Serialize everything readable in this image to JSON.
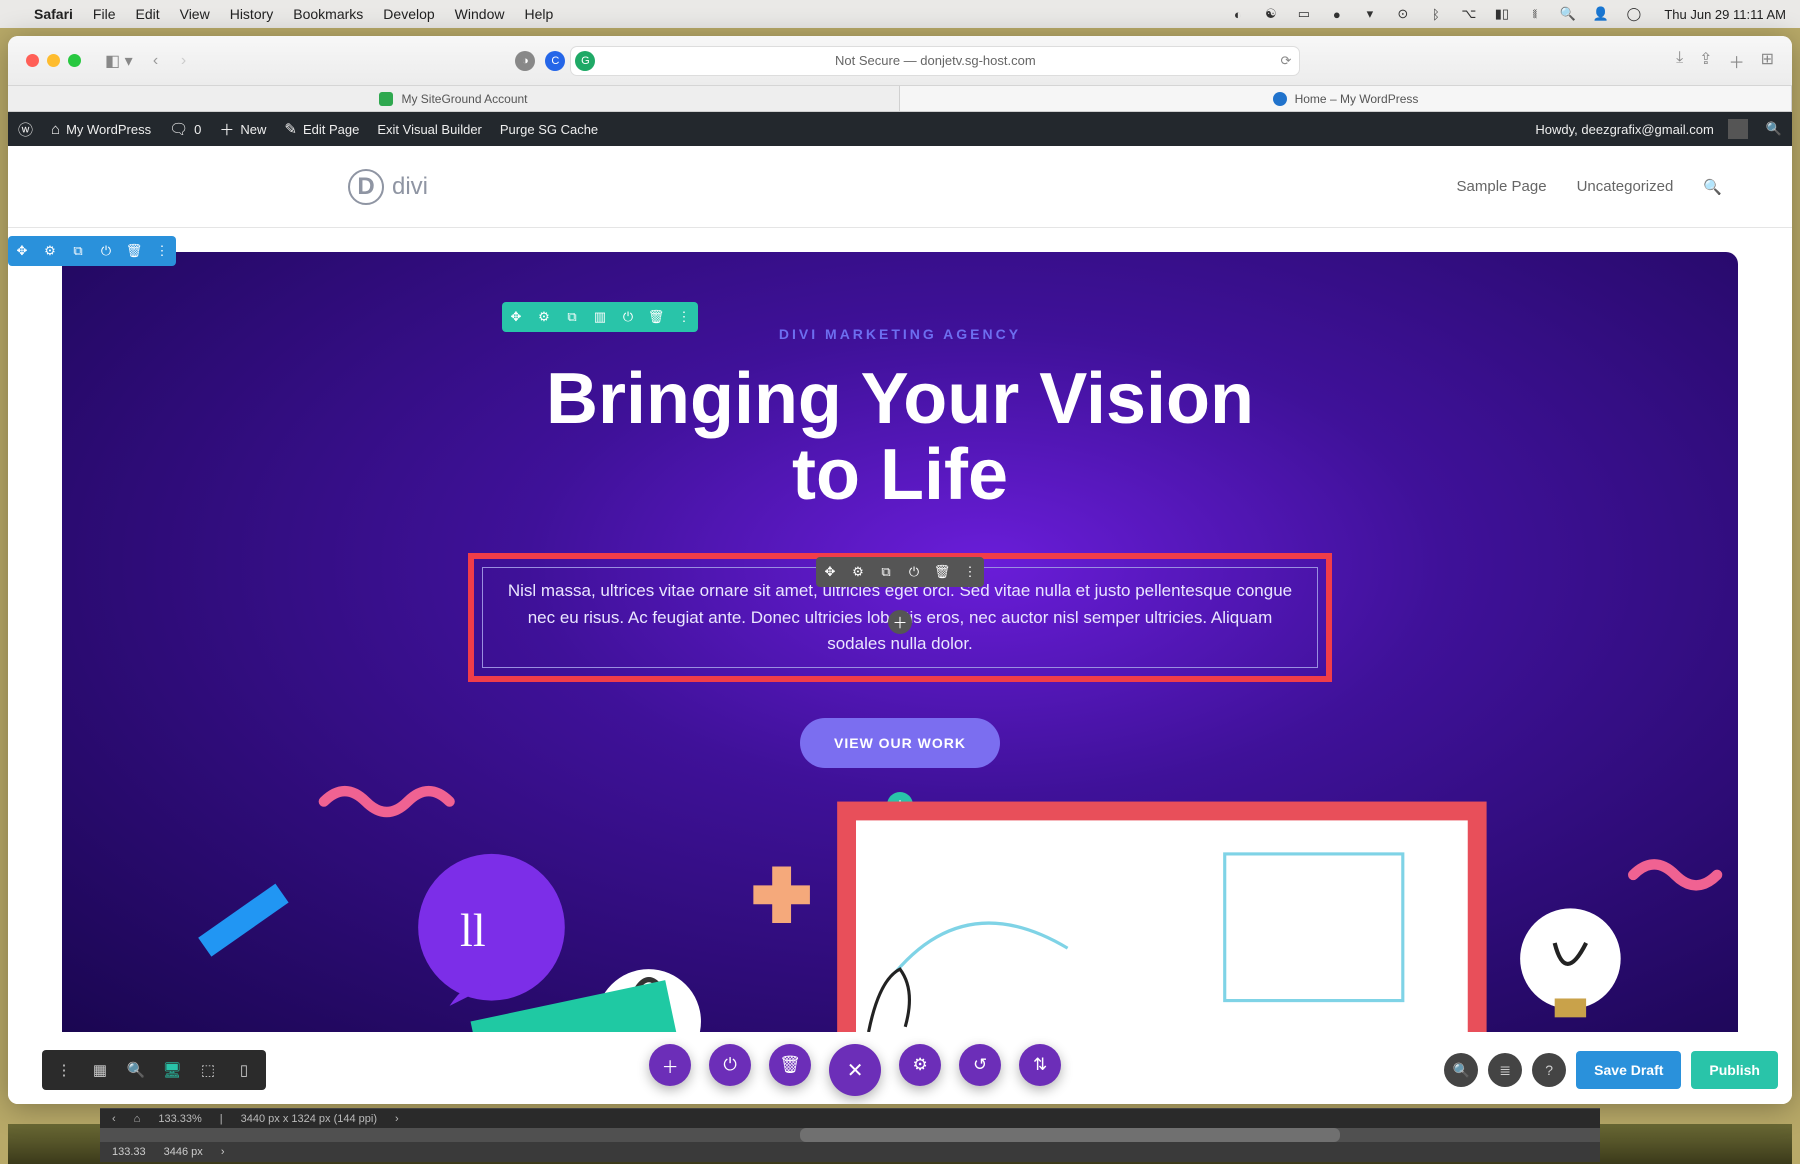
{
  "menubar": {
    "app": "Safari",
    "items": [
      "File",
      "Edit",
      "View",
      "History",
      "Bookmarks",
      "Develop",
      "Window",
      "Help"
    ],
    "datetime": "Thu Jun 29  11:11 AM"
  },
  "safari": {
    "url_label": "Not Secure — donjetv.sg-host.com",
    "tabs": [
      {
        "label": "My SiteGround Account",
        "active": false
      },
      {
        "label": "Home – My WordPress",
        "active": true
      }
    ]
  },
  "wpbar": {
    "site": "My WordPress",
    "comments": "0",
    "new": "New",
    "edit": "Edit Page",
    "exit": "Exit Visual Builder",
    "purge": "Purge SG Cache",
    "howdy": "Howdy, deezgrafix@gmail.com"
  },
  "site": {
    "logo_text": "divi",
    "nav": [
      "Sample Page",
      "Uncategorized"
    ]
  },
  "hero": {
    "eyebrow": "DIVI MARKETING AGENCY",
    "title_l1": "Bringing Your Vision",
    "title_l2": "to Life",
    "paragraph": "Nisl massa, ultrices vitae ornare sit amet, ultricies eget orci. Sed vitae nulla et justo pellentesque congue nec eu risus. Ac feugiat ante. Donec ultricies lobortis eros, nec auctor nisl semper ultricies. Aliquam sodales nulla dolor.",
    "cta": "VIEW OUR WORK"
  },
  "divibar": {
    "save_draft": "Save Draft",
    "publish": "Publish"
  },
  "ps": {
    "zoom1": "133.33%",
    "zoom2": "133.33",
    "dim_footer": "3446 px",
    "doc_info": "3440 px x 1324 px (144 ppi)"
  }
}
